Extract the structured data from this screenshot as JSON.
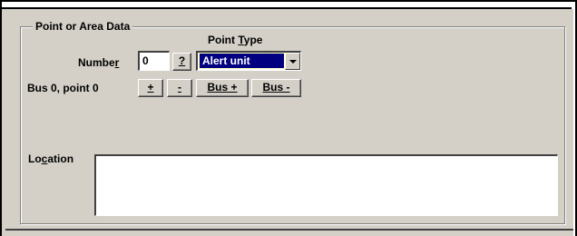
{
  "group": {
    "title": "Point or Area Data"
  },
  "point_type": {
    "label_pre": "Point ",
    "label_u": "T",
    "label_post": "ype",
    "value": "Alert unit"
  },
  "number": {
    "label_pre": "Numbe",
    "label_u": "r",
    "value": "0"
  },
  "buttons": {
    "help": "?",
    "plus": "+",
    "minus": "-",
    "bus_plus_u": "B",
    "bus_plus_rest": "us +",
    "bus_minus_u": "B",
    "bus_minus_rest": "us -"
  },
  "status": {
    "text": "Bus 0, point 0"
  },
  "location": {
    "label_pre": "Lo",
    "label_u": "c",
    "label_post": "ation",
    "value": ""
  },
  "icons": [
    "dropdown-arrow-icon"
  ]
}
